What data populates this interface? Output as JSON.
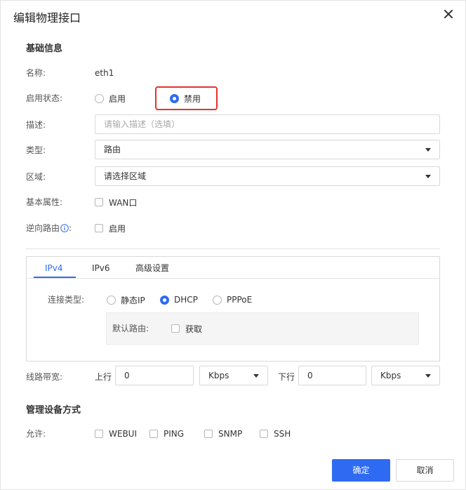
{
  "dialog": {
    "title": "编辑物理接口",
    "close_icon": "close-icon"
  },
  "basic": {
    "section_title": "基础信息",
    "name_label": "名称:",
    "name_value": "eth1",
    "status_label": "启用状态:",
    "status_options": [
      "启用",
      "禁用"
    ],
    "status_selected": "禁用",
    "desc_label": "描述:",
    "desc_placeholder": "请输入描述（选填）",
    "type_label": "类型:",
    "type_value": "路由",
    "zone_label": "区域:",
    "zone_value": "请选择区域",
    "attr_label": "基本属性:",
    "attr_option": "WAN口",
    "reverse_label": "逆向路由",
    "reverse_suffix": ":",
    "reverse_option": "启用"
  },
  "tabs": {
    "items": [
      "IPv4",
      "IPv6",
      "高级设置"
    ],
    "active": "IPv4",
    "conn_label": "连接类型:",
    "conn_options": [
      "静态IP",
      "DHCP",
      "PPPoE"
    ],
    "conn_selected": "DHCP",
    "default_route_label": "默认路由:",
    "default_route_option": "获取"
  },
  "bandwidth": {
    "label": "线路带宽:",
    "up_label": "上行",
    "up_value": "0",
    "up_unit": "Kbps",
    "down_label": "下行",
    "down_value": "0",
    "down_unit": "Kbps"
  },
  "manage": {
    "section_title": "管理设备方式",
    "allow_label": "允许:",
    "options": [
      "WEBUI",
      "PING",
      "SNMP",
      "SSH"
    ]
  },
  "buttons": {
    "confirm": "确定",
    "cancel": "取消"
  },
  "colors": {
    "accent": "#2f6bf2",
    "highlight": "#e5322d"
  }
}
